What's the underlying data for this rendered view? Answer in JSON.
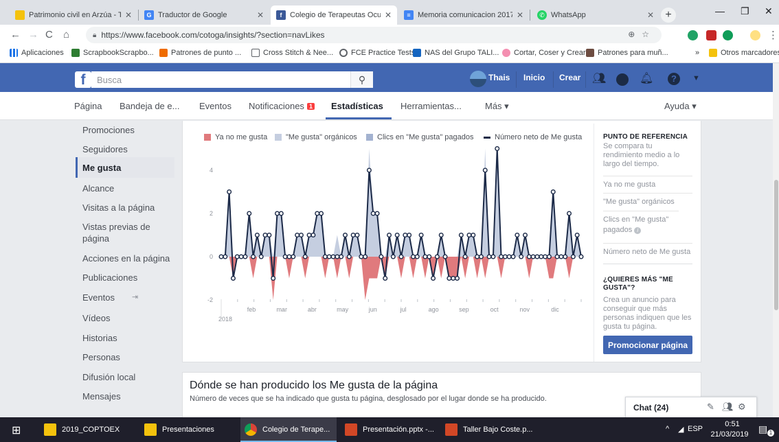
{
  "browser": {
    "tabs": [
      {
        "title": "Patrimonio civil en Arzúa - Turi",
        "favicon": "yellow-sun-icon",
        "active": false
      },
      {
        "title": "Traductor de Google",
        "favicon": "google-translate-icon",
        "active": false
      },
      {
        "title": "Colegio de Terapeutas Ocupac",
        "favicon": "facebook-icon",
        "active": true
      },
      {
        "title": "Memoria comunicacion 2017 - ",
        "favicon": "google-docs-icon",
        "active": false
      },
      {
        "title": "WhatsApp",
        "favicon": "whatsapp-icon",
        "active": false
      }
    ],
    "url": "https://www.facebook.com/cotoga/insights/?section=navLikes",
    "bookmarks": [
      {
        "label": "Aplicaciones",
        "icon": "apps-grid-icon"
      },
      {
        "label": "ScrapbookScrapbo...",
        "icon": "dollar-icon"
      },
      {
        "label": "Patrones de punto ...",
        "icon": "cross-stitch-icon"
      },
      {
        "label": "Cross Stitch & Nee...",
        "icon": "page-icon"
      },
      {
        "label": "FCE Practice Tests",
        "icon": "circle-icon"
      },
      {
        "label": "NAS del Grupo TALI...",
        "icon": "dsm-icon"
      },
      {
        "label": "Cortar, Coser y Crear",
        "icon": "flower-icon"
      },
      {
        "label": "Patrones para muñ...",
        "icon": "doll-icon"
      }
    ],
    "bookmarks_more": "»",
    "other_bookmarks": "Otros marcadores"
  },
  "facebook": {
    "search_placeholder": "Busca",
    "user_name": "Thais",
    "home": "Inicio",
    "create": "Crear"
  },
  "page_nav": {
    "items": [
      "Página",
      "Bandeja de e...",
      "Eventos",
      "Notificaciones",
      "Estadísticas",
      "Herramientas...",
      "Más ▾"
    ],
    "notifications_badge": "1",
    "help": "Ayuda ▾"
  },
  "left_menu": {
    "items": [
      "Promociones",
      "Seguidores",
      "Me gusta",
      "Alcance",
      "Visitas a la página",
      "Vistas previas de página",
      "Acciones en la página",
      "Publicaciones",
      "Eventos",
      "Vídeos",
      "Historias",
      "Personas",
      "Difusión local",
      "Mensajes"
    ],
    "active": "Me gusta"
  },
  "legend": [
    {
      "label": "Ya no me gusta",
      "color": "#e07a7d"
    },
    {
      "label": "\"Me gusta\" orgánicos",
      "color": "#c5cee0"
    },
    {
      "label": "Clics en \"Me gusta\" pagados",
      "color": "#a3b2d0"
    },
    {
      "label": "Número neto de Me gusta",
      "color": "#1c2a48"
    }
  ],
  "chart_data": {
    "type": "area",
    "x_axis_year": "2018",
    "x_tick_labels": [
      "feb",
      "mar",
      "abr",
      "may",
      "jun",
      "jul",
      "ago",
      "sep",
      "oct",
      "nov",
      "dic"
    ],
    "y_tick_labels": [
      "4",
      "2",
      "0",
      "-2"
    ],
    "ylim": [
      -2,
      5
    ],
    "grid": false,
    "series": [
      {
        "name": "Número neto de Me gusta",
        "values": [
          0,
          0,
          3,
          -1,
          0,
          0,
          0,
          2,
          0,
          1,
          0,
          1,
          1,
          -1,
          2,
          2,
          0,
          0,
          0,
          1,
          1,
          0,
          1,
          1,
          2,
          2,
          0,
          0,
          0,
          0,
          0,
          1,
          0,
          1,
          1,
          0,
          0,
          4,
          2,
          2,
          0,
          -1,
          1,
          0,
          1,
          0,
          1,
          1,
          0,
          0,
          1,
          0,
          0,
          -1,
          0,
          1,
          0,
          -1,
          -1,
          -1,
          1,
          0,
          1,
          1,
          0,
          0,
          4,
          0,
          0,
          5,
          0,
          0,
          0,
          0,
          1,
          0,
          1,
          0,
          0,
          0,
          0,
          0,
          0,
          3,
          0,
          0,
          0,
          2,
          0,
          1,
          0
        ]
      },
      {
        "name": "\"Me gusta\" orgánicos",
        "values": [
          0,
          0,
          3,
          0,
          0,
          0,
          0,
          2,
          0,
          1,
          0,
          1,
          1,
          0,
          2,
          2,
          0,
          0,
          0,
          1,
          1,
          0,
          1,
          1,
          2,
          2,
          0,
          0,
          0,
          1,
          0,
          1,
          0,
          1,
          1,
          0,
          0,
          5,
          2,
          2,
          0,
          0,
          1,
          0,
          1,
          0,
          1,
          1,
          0,
          0,
          1,
          0,
          0,
          0,
          0,
          1,
          0,
          0,
          0,
          0,
          1,
          0,
          1,
          1,
          0,
          0,
          5,
          0,
          0,
          5,
          0,
          0,
          0,
          0,
          1,
          0,
          1,
          0,
          0,
          0,
          0,
          0,
          0,
          3,
          0,
          0,
          0,
          2,
          0,
          1,
          0
        ]
      },
      {
        "name": "Ya no me gusta",
        "values": [
          0,
          0,
          0,
          -1,
          0,
          0,
          0,
          0,
          -1,
          0,
          0,
          0,
          0,
          -2,
          0,
          0,
          0,
          -1,
          0,
          0,
          0,
          -1,
          0,
          0,
          0,
          0,
          -1,
          0,
          0,
          -1,
          0,
          0,
          -1,
          0,
          0,
          0,
          -2,
          -1,
          -1,
          -1,
          0,
          -1,
          0,
          0,
          0,
          -1,
          0,
          0,
          -1,
          0,
          0,
          -1,
          0,
          -1,
          0,
          -1,
          0,
          -1,
          -1,
          -1,
          0,
          -1,
          0,
          0,
          -1,
          0,
          -1,
          0,
          0,
          0,
          -1,
          0,
          0,
          0,
          0,
          0,
          0,
          -1,
          0,
          0,
          0,
          0,
          -1,
          -1,
          0,
          0,
          0,
          -1,
          0,
          0,
          0
        ]
      }
    ]
  },
  "benchmark": {
    "title": "PUNTO DE REFERENCIA",
    "text": "Se compara tu rendimiento medio a lo largo del tiempo.",
    "items": [
      "Ya no me gusta",
      "\"Me gusta\" orgánicos",
      "Clics en \"Me gusta\" pagados",
      "Número neto de Me gusta"
    ],
    "promo_title": "¿QUIERES MÁS \"ME GUSTA\"?",
    "promo_text": "Crea un anuncio para conseguir que más personas indiquen que les gusta tu página.",
    "promo_button": "Promocionar página"
  },
  "section2": {
    "title": "Dónde se han producido los Me gusta de la página",
    "subtitle": "Número de veces que se ha indicado que gusta tu página, desglosado por el lugar donde se ha producido."
  },
  "chat": {
    "label": "Chat (24)"
  },
  "taskbar": {
    "items": [
      {
        "label": "2019_COPTOEX",
        "icon": "folder-icon"
      },
      {
        "label": "Presentaciones",
        "icon": "folder-icon"
      },
      {
        "label": "Colegio de Terape...",
        "icon": "chrome-icon"
      },
      {
        "label": "Presentación.pptx -...",
        "icon": "powerpoint-icon"
      },
      {
        "label": "Taller Bajo Coste.p...",
        "icon": "powerpoint-icon"
      }
    ],
    "language": "ESP",
    "time": "0:51",
    "date": "21/03/2019",
    "notifications_count": "1"
  },
  "colors": {
    "facebook_blue": "#4267b2",
    "taskbar": "#1f1f2b",
    "negative": "#e07a7d",
    "organic": "#c5cee0",
    "net_line": "#1c2a48"
  }
}
